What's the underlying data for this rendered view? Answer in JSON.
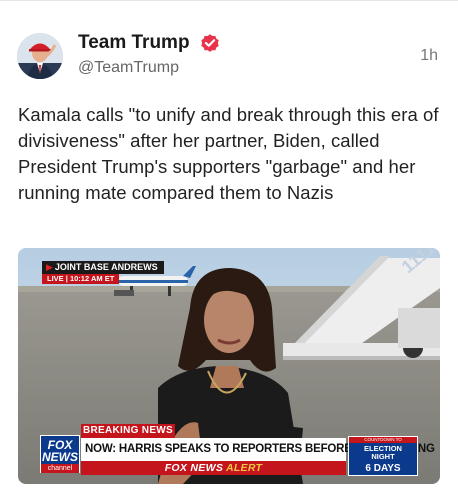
{
  "post": {
    "author": {
      "display_name": "Team Trump",
      "handle": "@TeamTrump",
      "verified": true,
      "avatar_icon": "profile-photo"
    },
    "timestamp": "1h",
    "text": "Kamala calls \"to unify and break through this era of divisiveness\" after her partner, Biden, called President Trump's supporters \"garbage\" and her running mate compared them to Nazis"
  },
  "media": {
    "location_label": "JOINT BASE ANDREWS",
    "live_label": "LIVE",
    "live_time": "10:12 AM ET",
    "breaking_label": "BREAKING NEWS",
    "headline": "NOW: HARRIS SPEAKS TO REPORTERS BEFORE CAMPAIGNING",
    "alert_brand": "FOX NEWS",
    "alert_word": "ALERT",
    "network_logo_line1": "FOX",
    "network_logo_line2": "NEWS",
    "network_logo_line3": "channel",
    "countdown_top": "COUNTDOWN TO",
    "countdown_line1": "ELECTION",
    "countdown_line2": "NIGHT",
    "countdown_days": "6 DAYS"
  },
  "colors": {
    "verified_badge": "#e8334a",
    "fox_blue": "#0b3a8c",
    "fox_red": "#c4151c",
    "alert_yellow": "#f4c542"
  }
}
